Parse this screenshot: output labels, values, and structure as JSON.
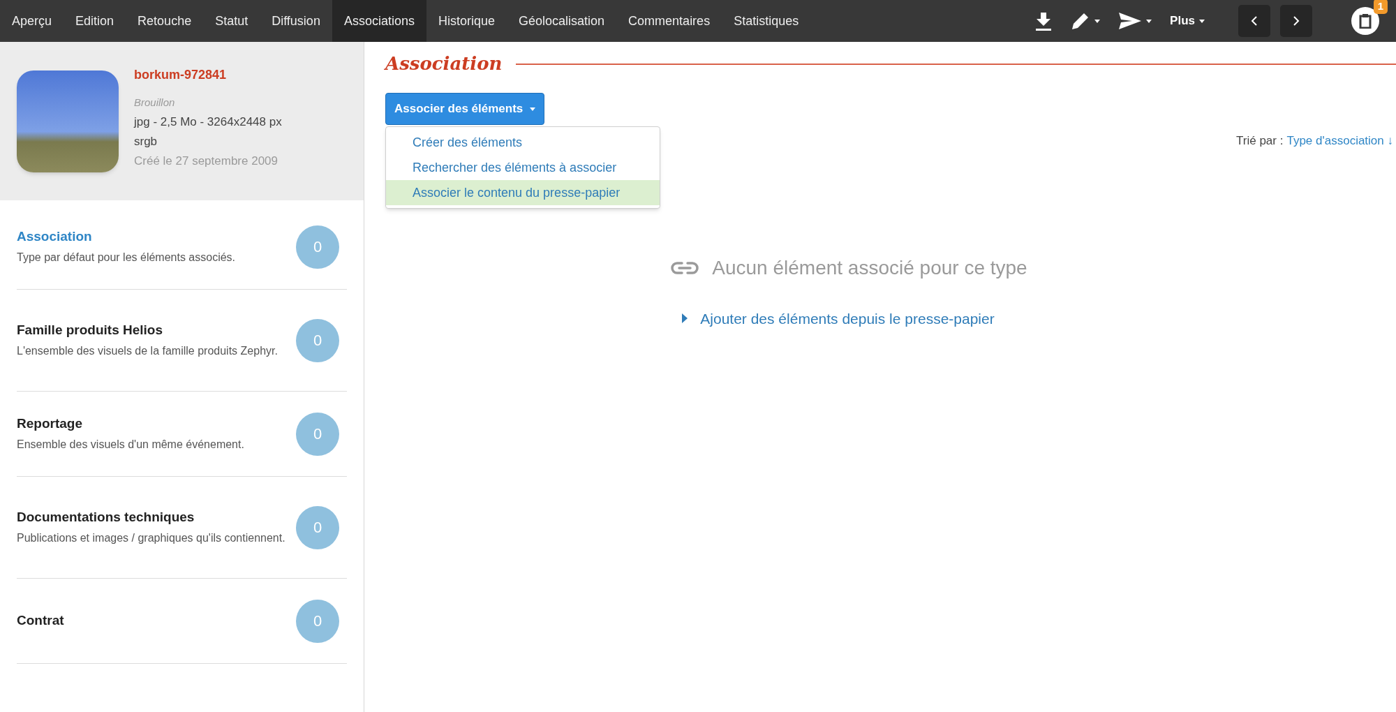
{
  "tabs": [
    {
      "label": "Aperçu",
      "selected": false
    },
    {
      "label": "Edition",
      "selected": false
    },
    {
      "label": "Retouche",
      "selected": false
    },
    {
      "label": "Statut",
      "selected": false
    },
    {
      "label": "Diffusion",
      "selected": false
    },
    {
      "label": "Associations",
      "selected": true
    },
    {
      "label": "Historique",
      "selected": false
    },
    {
      "label": "Géolocalisation",
      "selected": false
    },
    {
      "label": "Commentaires",
      "selected": false
    },
    {
      "label": "Statistiques",
      "selected": false
    }
  ],
  "toolbar": {
    "more_label": "Plus",
    "clipboard_count": "1"
  },
  "asset": {
    "name": "borkum-972841",
    "status": "Brouillon",
    "info": "jpg - 2,5 Mo - 3264x2448 px",
    "colorspace": "srgb",
    "created": "Créé le 27 septembre 2009"
  },
  "association_types": [
    {
      "title": "Association",
      "description": "Type par défaut pour les éléments associés.",
      "count": "0",
      "selected": true
    },
    {
      "title": "Famille produits Helios",
      "description": "L'ensemble des visuels de la famille produits Zephyr.",
      "count": "0",
      "selected": false
    },
    {
      "title": "Reportage",
      "description": "Ensemble des visuels d'un même événement.",
      "count": "0",
      "selected": false
    },
    {
      "title": "Documentations techniques",
      "description": "Publications et images / graphiques qu'ils contiennent.",
      "count": "0",
      "selected": false
    },
    {
      "title": "Contrat",
      "count": "0",
      "selected": false
    }
  ],
  "main": {
    "title": "Association",
    "associate_button": "Associer des éléments",
    "menu": [
      {
        "label": "Créer des éléments",
        "selected": false
      },
      {
        "label": "Rechercher des éléments à associer",
        "selected": false
      },
      {
        "label": "Associer le contenu du presse-papier",
        "selected": true
      }
    ],
    "sort_label": "Trié par :",
    "sort_value": "Type d'association ↓",
    "empty_message": "Aucun élément associé pour ce type",
    "add_link": "Ajouter des éléments depuis le presse-papier"
  }
}
